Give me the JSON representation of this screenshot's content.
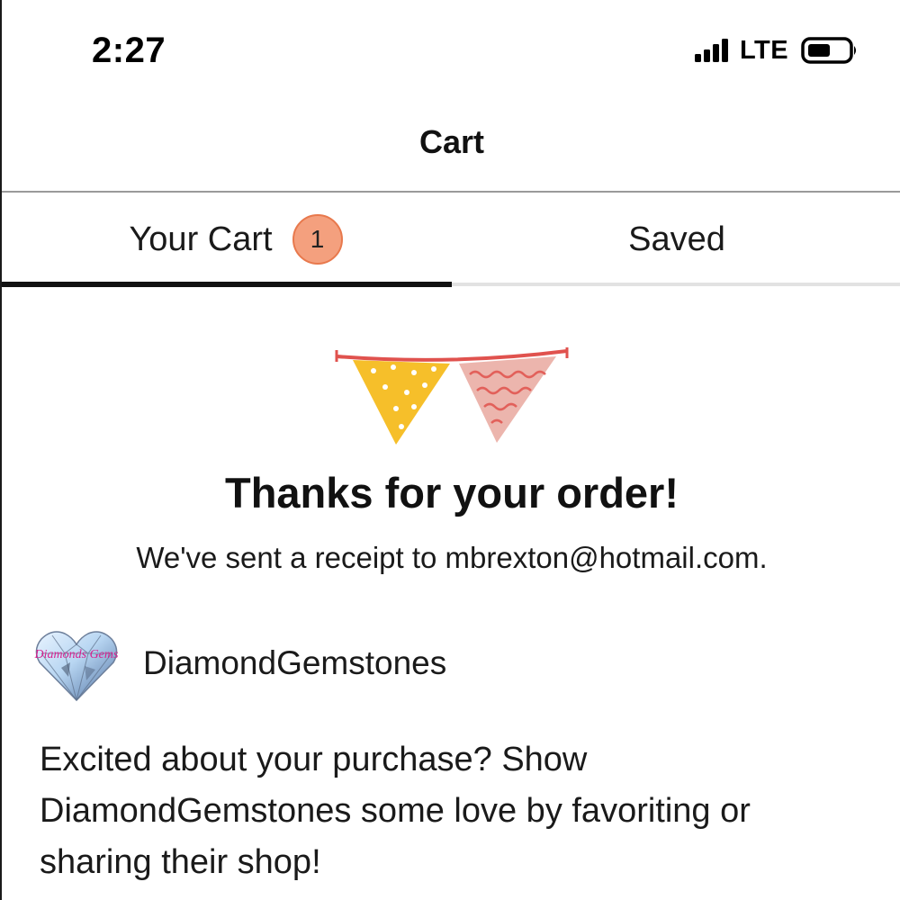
{
  "status_bar": {
    "time": "2:27",
    "network": "LTE",
    "icons": [
      "cellular-signal-icon",
      "battery-icon"
    ]
  },
  "header": {
    "title": "Cart"
  },
  "tabs": [
    {
      "label": "Your Cart",
      "badge": "1",
      "active": true
    },
    {
      "label": "Saved",
      "active": false
    }
  ],
  "confirmation": {
    "illustration": "bunting-flags-icon",
    "title": "Thanks for your order!",
    "receipt_message": "We've sent a receipt to mbrexton@hotmail.com."
  },
  "shop": {
    "avatar": "diamond-heart-logo",
    "avatar_text": "Diamonds Gems",
    "name": "DiamondGemstones",
    "message": "Excited about your purchase? Show DiamondGemstones some love by favoriting or sharing their shop!"
  },
  "colors": {
    "badge_fill": "#f4a07e",
    "badge_border": "#e8794d",
    "active_tab_underline": "#111111",
    "flag_yellow": "#f6bf2a",
    "flag_pink": "#ecb5ad",
    "bunting_string": "#e0524e"
  }
}
